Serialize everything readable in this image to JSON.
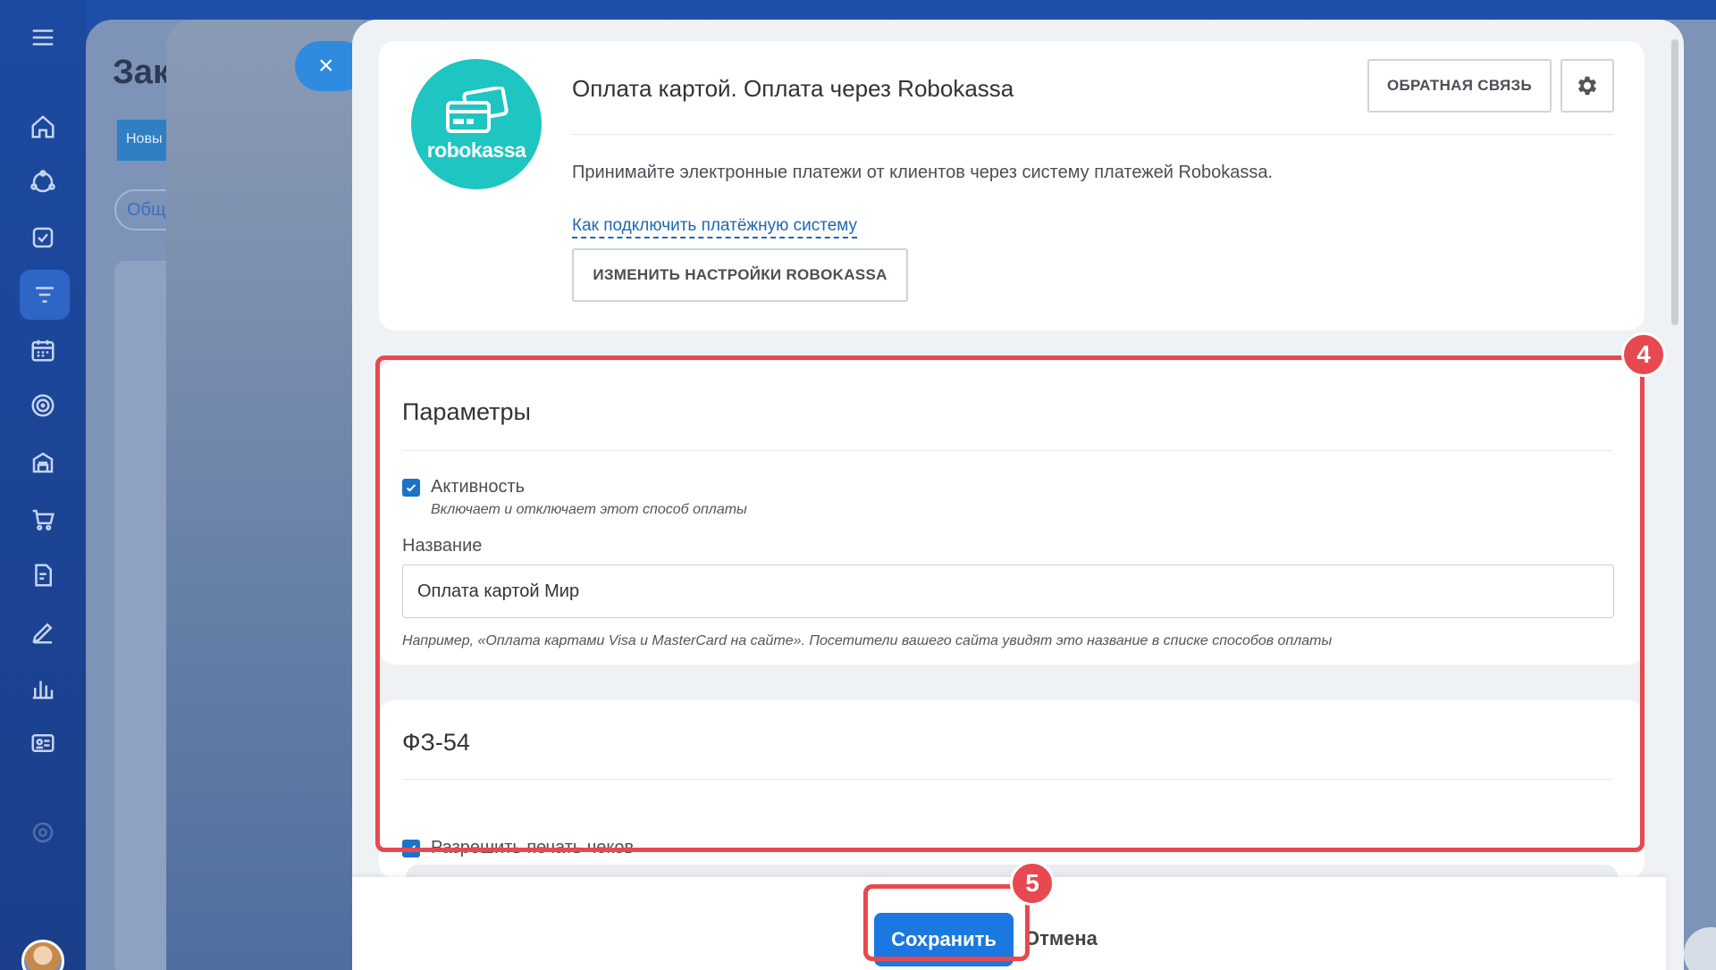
{
  "background_page": {
    "title": "Зак",
    "button_label": "Новы",
    "tab_label": "Общ"
  },
  "slider": {
    "close_glyph": "×",
    "header": {
      "logo_text": "robokassa",
      "title": "Оплата картой. Оплата через Robokassa",
      "feedback_button": "ОБРАТНАЯ СВЯЗЬ",
      "settings_icon": "gear-icon",
      "description": "Принимайте электронные платежи от клиентов через систему платежей Robokassa.",
      "howto_link": "Как подключить платёжную систему",
      "change_settings_button": "ИЗМЕНИТЬ НАСТРОЙКИ ROBOKASSA"
    },
    "params": {
      "title": "Параметры",
      "activity_label": "Активность",
      "activity_checked": true,
      "activity_hint": "Включает и отключает этот способ оплаты",
      "name_label": "Название",
      "name_value": "Оплата картой Мир",
      "name_hint": "Например, «Оплата картами Visa и MasterCard на сайте». Посетители вашего сайта увидят это название в списке способов оплаты"
    },
    "fz54": {
      "title": "ФЗ-54",
      "print_receipts_label": "Разрешить печать чеков",
      "print_receipts_checked": true
    },
    "footer": {
      "save_button": "Сохранить",
      "cancel_button": "Отмена"
    }
  },
  "annotations": {
    "params_badge": "4",
    "save_badge": "5",
    "highlight_color": "#e8484f"
  },
  "colors": {
    "primary_blue": "#1a78e0",
    "logo_teal": "#1fc5c0",
    "link_blue": "#2067b0"
  }
}
